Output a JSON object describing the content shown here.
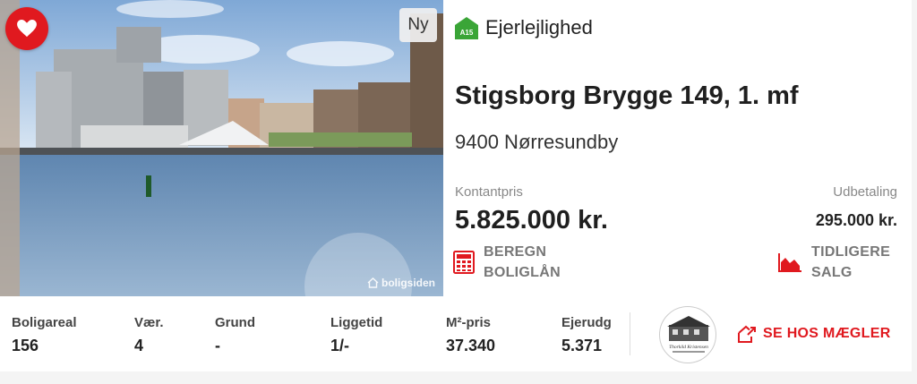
{
  "listing": {
    "new_badge": "Ny",
    "watermark": "boligsiden",
    "energy_label": "A15",
    "property_type": "Ejerlejlighed",
    "address": "Stigsborg Brygge 149, 1. mf",
    "city": "9400 Nørresundby",
    "cash_price_label": "Kontantpris",
    "cash_price": "5.825.000 kr.",
    "down_payment_label": "Udbetaling",
    "down_payment": "295.000 kr.",
    "calc_loan_line1": "BEREGN",
    "calc_loan_line2": "BOLIGLÅN",
    "prev_sales_line1": "TIDLIGERE",
    "prev_sales_line2": "SALG"
  },
  "stats": [
    {
      "label": "Boligareal",
      "value": "156"
    },
    {
      "label": "Vær.",
      "value": "4"
    },
    {
      "label": "Grund",
      "value": "-"
    },
    {
      "label": "Liggetid",
      "value": "1/-"
    },
    {
      "label": "M²-pris",
      "value": "37.340"
    },
    {
      "label": "Ejerudg",
      "value": "5.371"
    }
  ],
  "agent": {
    "logo_text": "Thorkild Kristensen",
    "button_label": "SE HOS MÆGLER"
  },
  "colors": {
    "accent": "#e0191f",
    "energy_green": "#3aa537"
  },
  "icons": {
    "favorite": "heart-icon",
    "energy": "energy-label-icon",
    "calc": "calculator-icon",
    "history": "area-chart-icon",
    "external": "external-link-icon"
  }
}
